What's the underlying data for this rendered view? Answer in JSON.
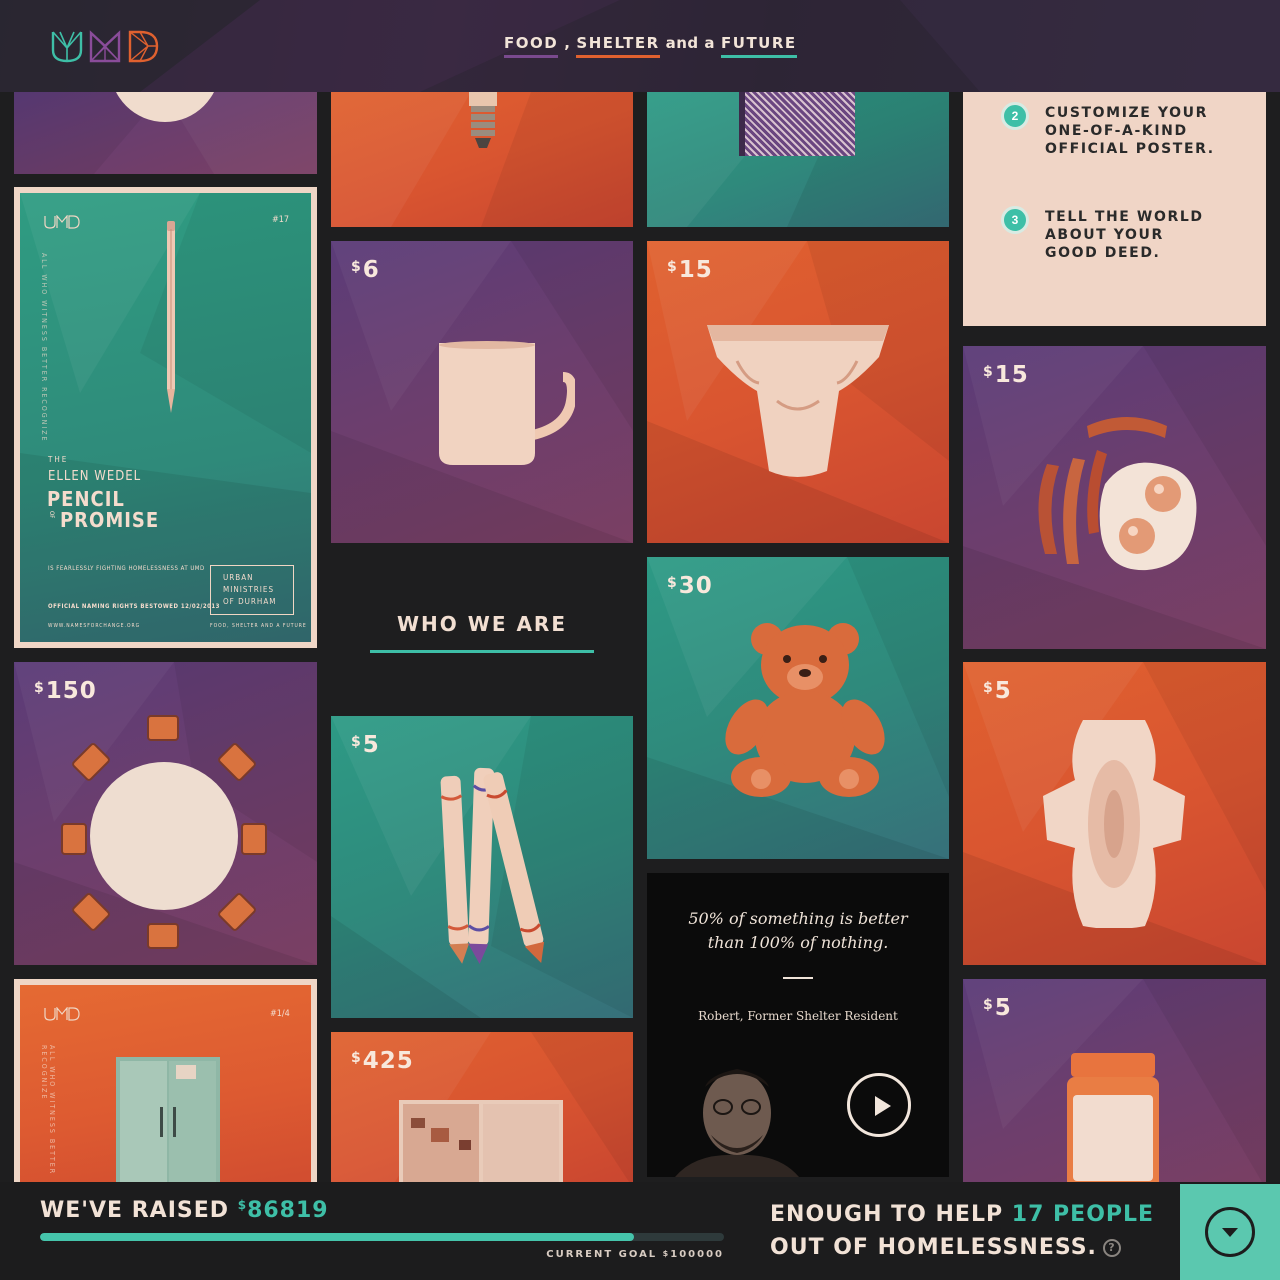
{
  "header": {
    "logo_alt": "UMD",
    "nav": [
      {
        "label": "FOOD"
      },
      {
        "label": "SHELTER"
      },
      {
        "label": "FUTURE"
      }
    ],
    "separator_1": ",",
    "separator_2": "and a"
  },
  "info_card": {
    "steps": [
      {
        "num": "2",
        "line1": "CUSTOMIZE YOUR",
        "line2": "ONE-OF-A-KIND",
        "line3": "OFFICIAL POSTER."
      },
      {
        "num": "3",
        "line1": "TELL THE WORLD",
        "line2": "ABOUT YOUR",
        "line3": "GOOD DEED."
      }
    ]
  },
  "poster_pencil": {
    "number": "#17",
    "side_text": "ALL WHO WITNESS BETTER RECOGNIZE",
    "the": "THE",
    "name": "ELLEN WEDEL",
    "title1": "PENCIL",
    "of": "OF",
    "title2": "PROMISE",
    "tagline": "IS FEARLESSLY FIGHTING HOMELESSNESS AT UMD",
    "rights": "OFFICIAL NAMING RIGHTS BESTOWED 12/02/2013",
    "url": "WWW.NAMESFORCHANGE.ORG",
    "box1": "URBAN",
    "box2": "MINISTRIES",
    "box3": "OF DURHAM",
    "footer": "FOOD, SHELTER AND A FUTURE"
  },
  "poster_fridge": {
    "number": "#1/4",
    "side_text": "ALL WHO WITNESS BETTER RECOGNIZE"
  },
  "tiles": {
    "mug": {
      "currency": "$",
      "price": "6",
      "icon": "mug-icon"
    },
    "diaper": {
      "currency": "$",
      "price": "15",
      "icon": "diaper-icon"
    },
    "bacon": {
      "currency": "$",
      "price": "15",
      "icon": "bacon-eggs-icon"
    },
    "table": {
      "currency": "$",
      "price": "150",
      "icon": "table-chairs-icon"
    },
    "crayons": {
      "currency": "$",
      "price": "5",
      "icon": "crayons-icon"
    },
    "bear": {
      "currency": "$",
      "price": "30",
      "icon": "teddy-bear-icon"
    },
    "pad": {
      "currency": "$",
      "price": "5",
      "icon": "sanitary-pad-icon"
    },
    "cabinet": {
      "currency": "$",
      "price": "425",
      "icon": "cabinet-icon"
    },
    "peanut": {
      "currency": "$",
      "price": "5",
      "icon": "peanut-butter-icon"
    }
  },
  "who_we_are": "WHO WE ARE",
  "quote": {
    "line1": "50% of something is better",
    "line2": "than 100% of nothing.",
    "attribution": "Robert, Former Shelter Resident"
  },
  "footer": {
    "raised_label": "WE'VE RAISED",
    "currency": "$",
    "raised_amount": "86819",
    "progress_fraction": 0.868,
    "goal_label": "CURRENT GOAL",
    "goal_amount": "100000",
    "enough_line1_a": "ENOUGH TO HELP",
    "enough_line1_b": "17 PEOPLE",
    "enough_line2": "OUT OF HOMELESSNESS.",
    "help_icon": "?"
  },
  "colors": {
    "teal": "#3ebfa7",
    "orange": "#e0612f",
    "purple": "#6b3e72",
    "cream": "#f0d5c6",
    "background": "#1e1e1f"
  }
}
